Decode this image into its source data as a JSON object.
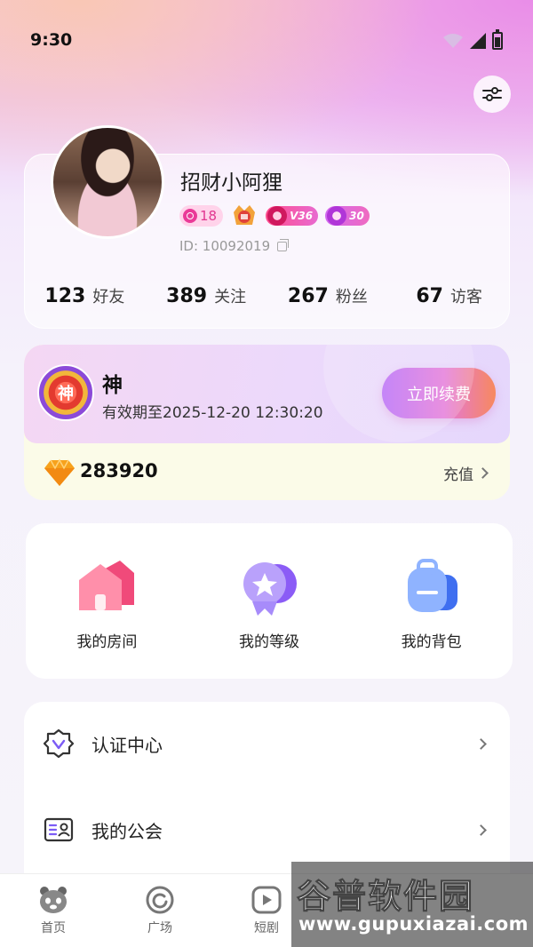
{
  "status_bar": {
    "time": "9:30"
  },
  "profile": {
    "nickname": "招财小阿狸",
    "level": "18",
    "badge_pink_text": "V36",
    "badge_purple_text": "30",
    "user_id": "ID: 10092019",
    "stats": [
      {
        "value": "123",
        "label": "好友"
      },
      {
        "value": "389",
        "label": "关注"
      },
      {
        "value": "267",
        "label": "粉丝"
      },
      {
        "value": "67",
        "label": "访客"
      }
    ]
  },
  "vip": {
    "emblem_text": "神",
    "name": "神",
    "expire_text": "有效期至2025-12-20 12:30:20",
    "renew_label": "立即续费",
    "diamonds": "283920",
    "recharge_label": "充值"
  },
  "actions": [
    {
      "label": "我的房间",
      "icon": "house-icon"
    },
    {
      "label": "我的等级",
      "icon": "level-star-icon"
    },
    {
      "label": "我的背包",
      "icon": "backpack-icon"
    }
  ],
  "menu": [
    {
      "label": "认证中心",
      "icon": "verify-badge-icon"
    },
    {
      "label": "我的公会",
      "icon": "guild-card-icon"
    }
  ],
  "tabs": [
    {
      "label": "首页",
      "icon": "panda-icon"
    },
    {
      "label": "广场",
      "icon": "square-icon"
    },
    {
      "label": "短剧",
      "icon": "play-icon"
    }
  ],
  "watermark": {
    "title": "谷普软件园",
    "url": "www.gupuxiazai.com"
  },
  "colors": {
    "accent_pink": "#e1358f",
    "renew_gradient_start": "#b86bf7",
    "renew_gradient_end": "#f7895f"
  }
}
